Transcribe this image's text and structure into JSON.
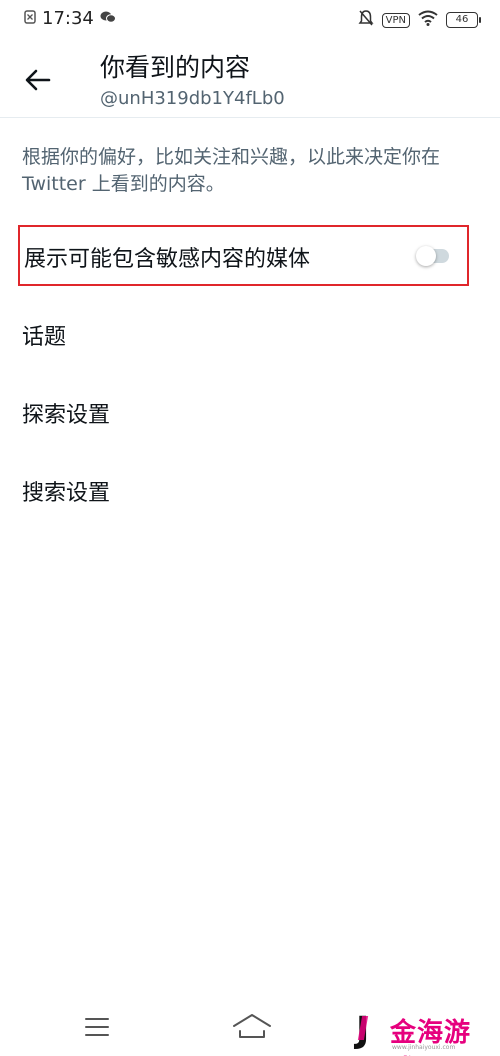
{
  "status_bar": {
    "time": "17:34",
    "vpn_label": "VPN",
    "battery": "46"
  },
  "header": {
    "title": "你看到的内容",
    "subtitle": "@unH319db1Y4fLb0"
  },
  "description": "根据你的偏好，比如关注和兴趣，以此来决定你在 Twitter 上看到的内容。",
  "settings": {
    "sensitive_media_label": "展示可能包含敏感内容的媒体",
    "sensitive_media_enabled": false,
    "topics_label": "话题",
    "explore_label": "探索设置",
    "search_label": "搜索设置"
  },
  "watermark": {
    "text": "金海游戏",
    "url": "www.jinhaiyouxi.com"
  },
  "colors": {
    "highlight": "#e0262b",
    "secondary_text": "#536471",
    "watermark": "#e6007e"
  }
}
